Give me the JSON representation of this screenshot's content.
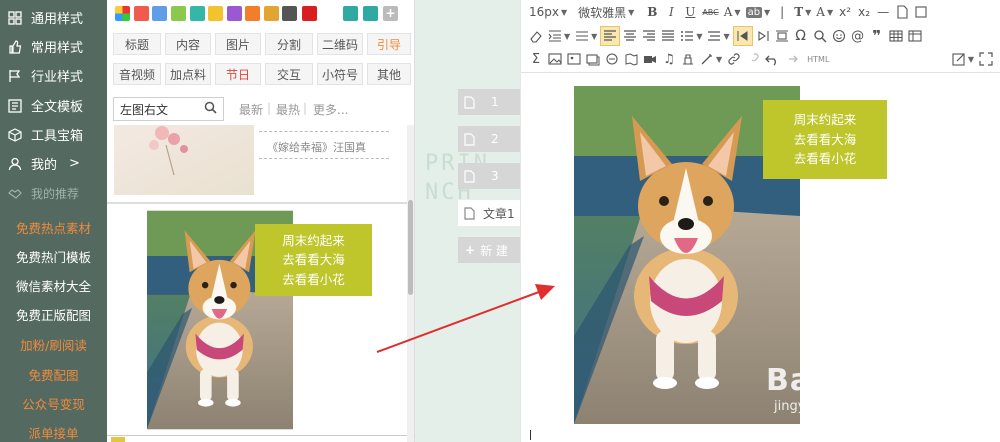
{
  "sidebar": {
    "items": [
      {
        "label": "通用样式",
        "icon": "grid-icon"
      },
      {
        "label": "常用样式",
        "icon": "thumbs-up-icon"
      },
      {
        "label": "行业样式",
        "icon": "flag-icon"
      },
      {
        "label": "全文模板",
        "icon": "template-icon"
      },
      {
        "label": "工具宝箱",
        "icon": "cube-icon"
      },
      {
        "label": "我的",
        "icon": "user-icon",
        "arrow": ">"
      },
      {
        "label": "我的推荐",
        "icon": "handshake-icon"
      }
    ],
    "links": [
      {
        "label": "免费热点素材",
        "color": "orange"
      },
      {
        "label": "免费热门模板",
        "color": "white"
      },
      {
        "label": "微信素材大全",
        "color": "white"
      },
      {
        "label": "免费正版配图",
        "color": "white"
      },
      {
        "label": "加粉/刷阅读",
        "color": "orange"
      },
      {
        "label": "免费配图",
        "color": "orange"
      },
      {
        "label": "公众号变现",
        "color": "orange"
      },
      {
        "label": "派单接单",
        "color": "orange"
      }
    ]
  },
  "panel": {
    "swatches": [
      "#e33a3a",
      "#f05a4f",
      "#5f9de9",
      "#8cc84b",
      "#36b6a6",
      "#f3c22d",
      "#9a58d3",
      "#f27d2b",
      "#e2a532",
      "#555555",
      "#d81e1e",
      "#2eaaa3",
      "#2eaaa3"
    ],
    "categories_row1": [
      {
        "label": "标题",
        "color": "normal"
      },
      {
        "label": "内容",
        "color": "normal"
      },
      {
        "label": "图片",
        "color": "normal"
      },
      {
        "label": "分割",
        "color": "normal"
      },
      {
        "label": "二维码",
        "color": "normal"
      },
      {
        "label": "引导",
        "color": "orange"
      }
    ],
    "categories_row2": [
      {
        "label": "音视频",
        "color": "normal"
      },
      {
        "label": "加点料",
        "color": "normal"
      },
      {
        "label": "节日",
        "color": "red"
      },
      {
        "label": "交互",
        "color": "normal"
      },
      {
        "label": "小符号",
        "color": "normal"
      },
      {
        "label": "其他",
        "color": "normal"
      }
    ],
    "search": {
      "value": "左图右文"
    },
    "filters": [
      "最新",
      "最热",
      "更多..."
    ],
    "template_caption": "《嫁给幸福》汪国真",
    "card": {
      "overlay_lines": [
        "周末约起来",
        "去看看大海",
        "去看看小花"
      ]
    }
  },
  "pages": {
    "tabs": [
      {
        "label": "1",
        "active": false
      },
      {
        "label": "2",
        "active": false
      },
      {
        "label": "3",
        "active": false
      },
      {
        "label": "文章1",
        "active": true
      }
    ],
    "new_label": "新 建"
  },
  "editor": {
    "font_size": "16px",
    "font_family": "微软雅黑",
    "toolbar_labels": {
      "abc": "ABC",
      "html": "HTML"
    },
    "overlay_lines": [
      "周末约起来",
      "去看看大海",
      "去看看小花"
    ],
    "watermark_main": "Bai 经验",
    "watermark_sub": "jingyan.baidu.com"
  },
  "colors": {
    "accent_olive": "#bfc62c",
    "sidebar_bg": "#546a61",
    "arrow_red": "#e02e2e",
    "link_orange": "#f08a3c"
  }
}
